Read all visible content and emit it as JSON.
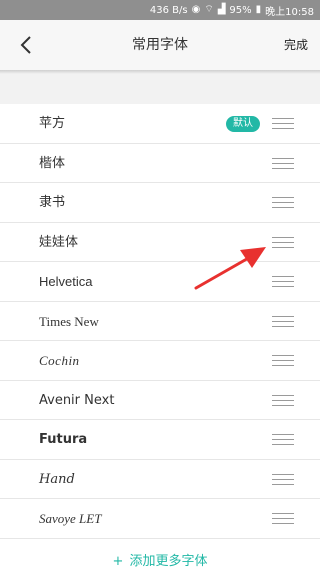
{
  "status_bar": {
    "network_speed": "436 B/s",
    "battery": "95%",
    "time": "晚上10:58",
    "icons": [
      "eye-icon",
      "wifi-icon",
      "signal-icon",
      "battery-icon"
    ]
  },
  "nav": {
    "title": "常用字体",
    "done_label": "完成",
    "back_icon": "back-chevron-icon"
  },
  "fonts": [
    {
      "label": "苹方",
      "badge": "默认"
    },
    {
      "label": "楷体"
    },
    {
      "label": "隶书"
    },
    {
      "label": "娃娃体"
    },
    {
      "label": "Helvetica"
    },
    {
      "label": "Times New"
    },
    {
      "label": "Cochin"
    },
    {
      "label": "Avenir Next"
    },
    {
      "label": "Futura"
    },
    {
      "label": "Hand"
    },
    {
      "label": "Savoye LET"
    }
  ],
  "footer": {
    "add_more_label": "添加更多字体",
    "plus": "+"
  },
  "colors": {
    "accent": "#22b8a6",
    "status_bar": "#8f8f8f",
    "annotation_arrow": "#e8312f"
  }
}
